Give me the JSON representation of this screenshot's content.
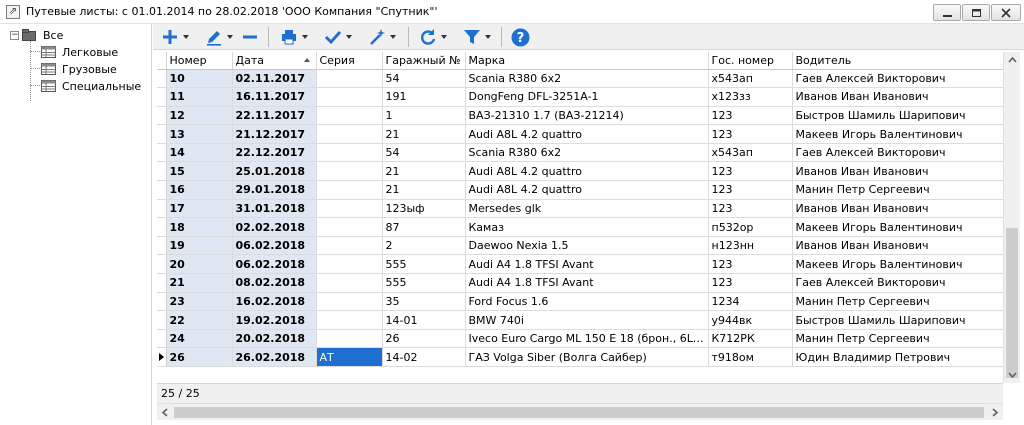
{
  "window": {
    "title": "Путевые листы: с 01.01.2014 по 28.02.2018  'ООО Компания \"Спутник\"'"
  },
  "tree": {
    "root": "Все",
    "items": [
      "Легковые",
      "Грузовые",
      "Специальные"
    ]
  },
  "toolbar": {
    "items": [
      "add-icon",
      "edit-icon",
      "delete-icon",
      "print-icon",
      "check-icon",
      "wand-icon",
      "refresh-icon",
      "filter-icon",
      "help-icon"
    ],
    "accent": "#1e6fd0"
  },
  "grid": {
    "columns": [
      "Номер",
      "Дата",
      "Серия",
      "Гаражный №",
      "Марка",
      "Гос. номер",
      "Водитель"
    ],
    "sorted_column": "Дата",
    "rows": [
      [
        "10",
        "02.11.2017",
        "",
        "54",
        "Scania R380  6x2",
        "х543ап",
        "Гаев Алексей Викторович"
      ],
      [
        "11",
        "16.11.2017",
        "",
        "191",
        "DongFeng DFL-3251A-1",
        "х123зз",
        "Иванов Иван Иванович"
      ],
      [
        "12",
        "22.11.2017",
        "",
        "1",
        "ВАЗ-21310 1.7 (ВАЗ-21214)",
        "123",
        "Быстров Шамиль Шарипович"
      ],
      [
        "13",
        "21.12.2017",
        "",
        "21",
        "Audi A8L 4.2 quattro",
        "123",
        "Макеев Игорь Валентинович"
      ],
      [
        "14",
        "22.12.2017",
        "",
        "54",
        "Scania R380  6x2",
        "х543ап",
        "Гаев Алексей Викторович"
      ],
      [
        "15",
        "25.01.2018",
        "",
        "21",
        "Audi A8L 4.2 quattro",
        "123",
        "Иванов Иван Иванович"
      ],
      [
        "16",
        "29.01.2018",
        "",
        "21",
        "Audi A8L 4.2 quattro",
        "123",
        "Манин Петр Сергеевич"
      ],
      [
        "17",
        "31.01.2018",
        "",
        "123ыф",
        "Mersedes glk",
        "123",
        "Иванов Иван Иванович"
      ],
      [
        "18",
        "02.02.2018",
        "",
        "87",
        "Камаз",
        "п532ор",
        "Макеев Игорь Валентинович"
      ],
      [
        "19",
        "06.02.2018",
        "",
        "2",
        "Daewoo Nexia 1.5",
        "н123нн",
        "Иванов Иван Иванович"
      ],
      [
        "20",
        "06.02.2018",
        "",
        "555",
        "Audi A4 1.8 TFSI Avant",
        "123",
        "Макеев Игорь Валентинович"
      ],
      [
        "21",
        "08.02.2018",
        "",
        "555",
        "Audi A4 1.8 TFSI Avant",
        "123",
        "Гаев Алексей Викторович"
      ],
      [
        "23",
        "16.02.2018",
        "",
        "35",
        "Ford Focus 1.6",
        "1234",
        "Манин Петр Сергеевич"
      ],
      [
        "22",
        "19.02.2018",
        "",
        "14-01",
        "BMW 740i",
        "у944вк",
        "Быстров Шамиль Шарипович"
      ],
      [
        "24",
        "20.02.2018",
        "",
        "26",
        "Iveco Euro Cargo ML 150 E 18 (брон., 6L-5,861...",
        "К712РК",
        "Манин Петр Сергеевич"
      ],
      [
        "26",
        "26.02.2018",
        "АТ",
        "14-02",
        "ГАЗ Volga Siber (Волга Сайбер)",
        "т918ом",
        "Юдин Владимир Петрович"
      ]
    ],
    "current_row": 15
  },
  "footer": {
    "record_count": "25 / 25"
  }
}
